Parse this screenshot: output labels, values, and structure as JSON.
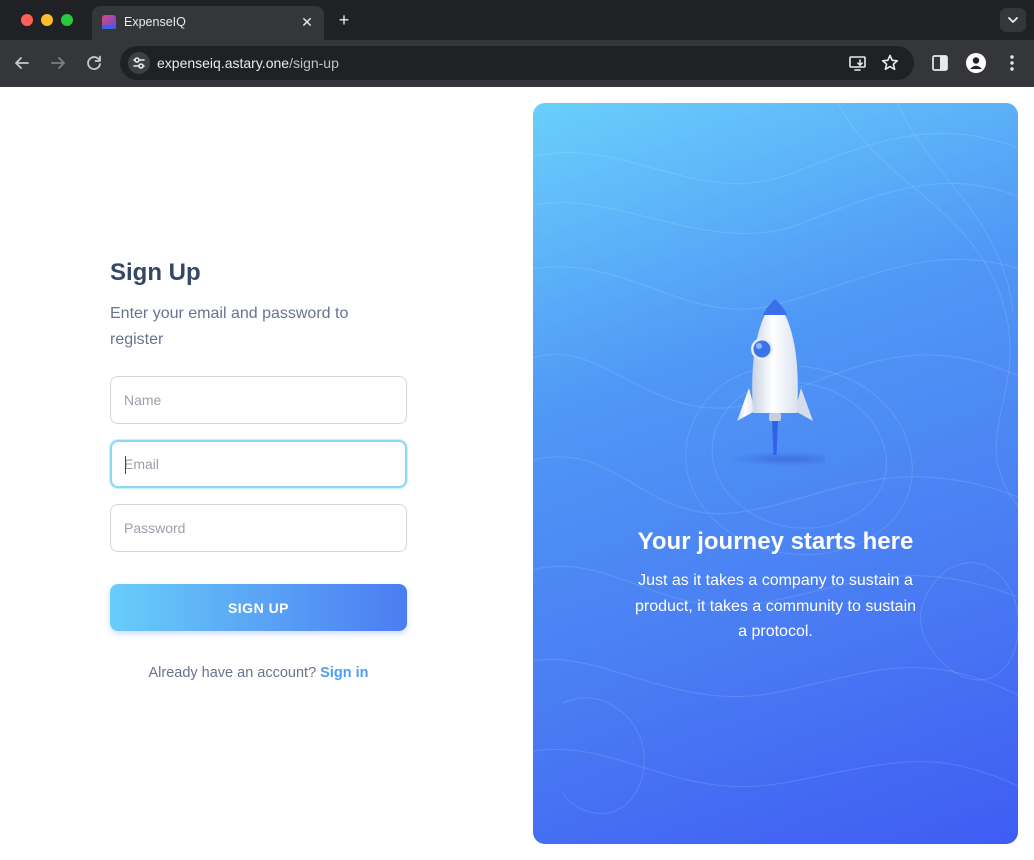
{
  "browser": {
    "tab_title": "ExpenseIQ",
    "url_host": "expenseiq.astary.one",
    "url_path": "/sign-up",
    "icons": [
      "back-icon",
      "forward-icon",
      "reload-icon",
      "site-info-icon",
      "install-app-icon",
      "bookmark-star-icon",
      "side-panel-icon",
      "profile-icon",
      "menu-icon",
      "tab-close-icon",
      "new-tab-icon",
      "tab-search-icon"
    ]
  },
  "form": {
    "title": "Sign Up",
    "subtitle": "Enter your email and password to register",
    "name_placeholder": "Name",
    "email_placeholder": "Email",
    "password_placeholder": "Password",
    "name_value": "",
    "email_value": "",
    "password_value": "",
    "focused_field": "email",
    "submit_label": "SIGN UP",
    "signin_prompt": "Already have an account?",
    "signin_link": "Sign in"
  },
  "hero": {
    "illustration": "rocket-illustration",
    "title": "Your journey starts here",
    "text": "Just as it takes a company to sustain a product, it takes a community to sustain a protocol."
  },
  "colors": {
    "heading": "#344767",
    "body_text": "#67748e",
    "link": "#4d9ff0",
    "button_gradient_start": "#68cdf9",
    "button_gradient_end": "#4c7cf2",
    "hero_gradient_start": "#6acffb",
    "hero_gradient_end": "#3f5cf3",
    "focus_ring": "#8fd8f5"
  }
}
